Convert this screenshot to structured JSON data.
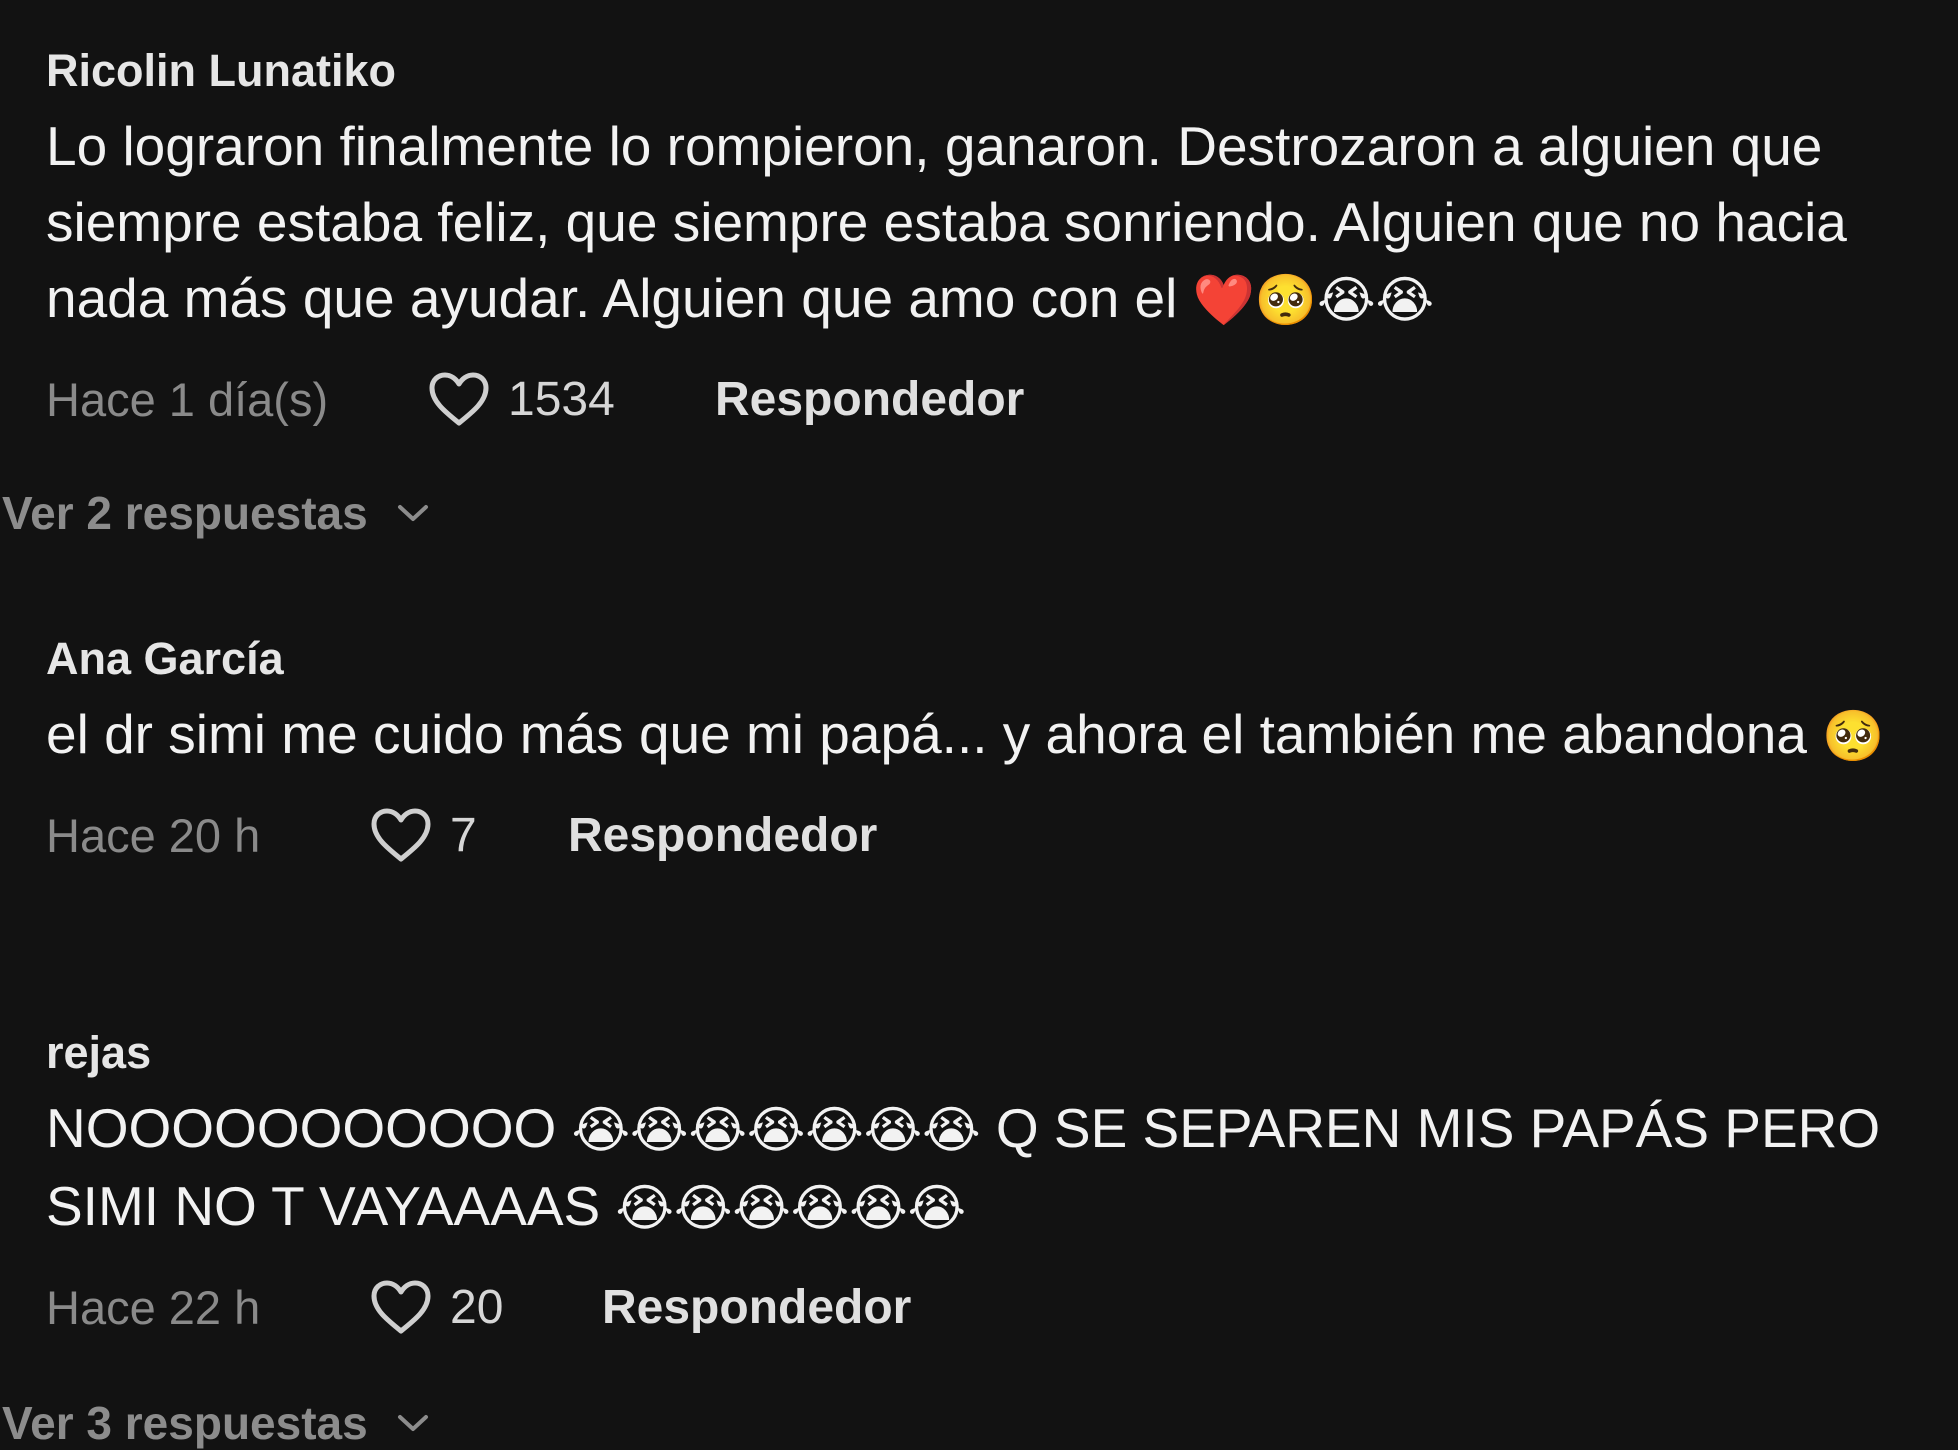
{
  "comments": [
    {
      "username": "Ricolin Lunatiko",
      "text_plain": "Lo lograron finalmente lo rompieron, ganaron. Destrozaron a alguien que siempre estaba feliz, que siempre estaba sonriendo. Alguien que no hacia nada más que ayudar. Alguien que amo con el ",
      "emojis": "❤️🥺😭😭",
      "time": "Hace 1 día(s)",
      "likes": "1534",
      "reply_label": "Respondedor"
    },
    {
      "username": "Ana García",
      "text_plain": "el dr simi me cuido más que mi papá... y ahora el también me abandona ",
      "emojis": "🥺",
      "time": "Hace 20 h",
      "likes": "7",
      "reply_label": "Respondedor"
    },
    {
      "username": "rejas",
      "text_part1": "NOOOOOOOOOOO ",
      "emojis1": "😭😭😭😭😭😭😭",
      "text_part2": " Q SE SEPAREN MIS PAPÁS PERO SIMI NO T VAYAAAAS ",
      "emojis2": "😭😭😭😭😭😭",
      "time": "Hace 22 h",
      "likes": "20",
      "reply_label": "Respondedor"
    }
  ],
  "view_replies": [
    {
      "label": "Ver 2 respuestas"
    },
    {
      "label": "Ver 3 respuestas"
    }
  ],
  "colors": {
    "background": "#121212",
    "muted": "#8a8a8a",
    "text": "#f2f2f2"
  }
}
